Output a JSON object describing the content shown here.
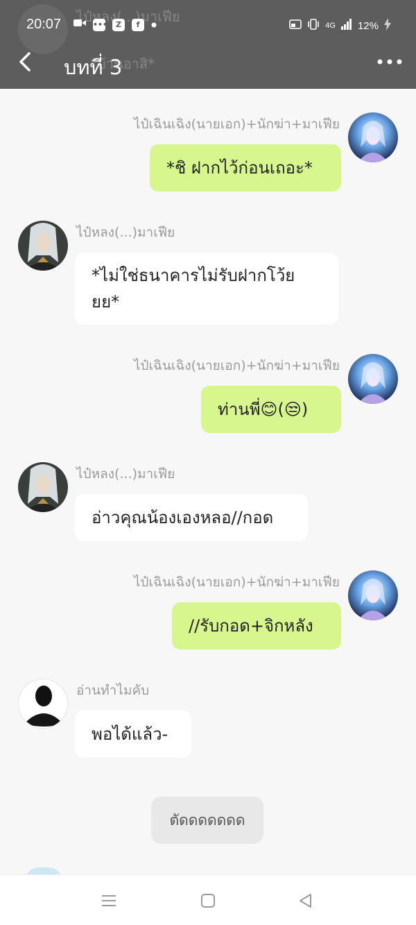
{
  "status_bar": {
    "time": "20:07",
    "app_icons": [
      "video-camera-icon",
      "line-icon",
      "zalo-icon",
      "facebook-icon",
      "dot-icon"
    ],
    "network": "4G",
    "battery": "12%"
  },
  "header": {
    "title": "บทที่ 3",
    "ghost_name": "ไป๋หลง(...)มาเฟีย",
    "ghost_text": "*บ้านอาสิ*"
  },
  "messages": [
    {
      "side": "right",
      "sender": "ไป๋เฉินเฉิง(นายเอก)+นักฆ่า+มาเฟีย",
      "text": "*ชิ ฝากไว้ก่อนเถอะ*"
    },
    {
      "side": "left",
      "sender": "ไป๋หลง(...)มาเฟีย",
      "text": "*ไม่ใช่ธนาคารไม่รับฝากโว้ย ยย*"
    },
    {
      "side": "right",
      "sender": "ไป๋เฉินเฉิง(นายเอก)+นักฆ่า+มาเฟีย",
      "text": "ท่านพี่😊(😒)"
    },
    {
      "side": "left",
      "sender": "ไป๋หลง(...)มาเฟีย",
      "text": "อ่าวคุณน้องเองหลอ//กอด"
    },
    {
      "side": "right",
      "sender": "ไป๋เฉินเฉิง(นายเอก)+นักฆ่า+มาเฟีย",
      "text": "//รับกอด+จิกหลัง"
    },
    {
      "side": "left",
      "sender": "อ่านทำไมคับ",
      "text": "พอได้แล้ว-"
    }
  ],
  "system_chip": "ตัดดดดดดด",
  "colors": {
    "header_bg": "#5d5d5d",
    "bubble_right": "#d8f68e",
    "bubble_left": "#ffffff",
    "chat_bg": "#f7f7f7"
  },
  "nav_icons": [
    "menu-icon",
    "home-square-icon",
    "back-triangle-icon"
  ]
}
